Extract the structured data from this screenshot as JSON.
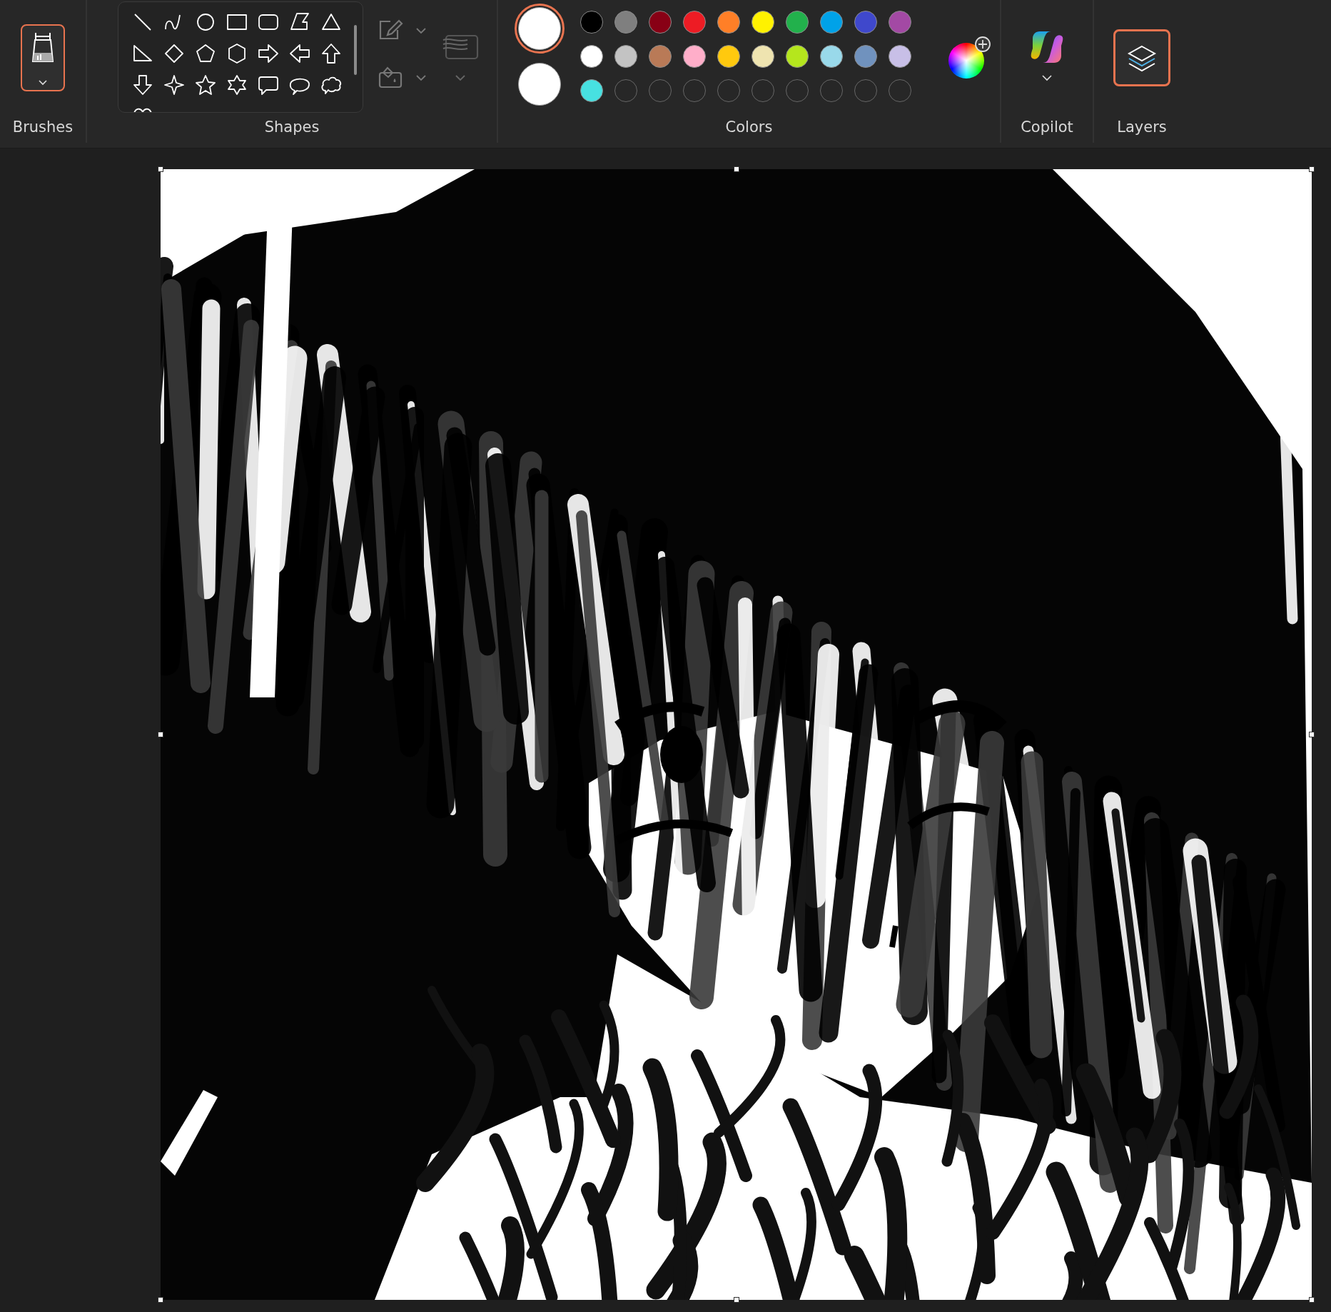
{
  "toolbar": {
    "brushes": {
      "label": "Brushes",
      "selected": true
    },
    "shapes": {
      "label": "Shapes"
    },
    "colors": {
      "label": "Colors",
      "current": [
        {
          "color": "#ffffff",
          "selected": true
        },
        {
          "color": "#ffffff",
          "selected": false
        }
      ],
      "palette": [
        {
          "kind": "swatch",
          "color": "#000000"
        },
        {
          "kind": "swatch",
          "color": "#7f7f7f"
        },
        {
          "kind": "swatch",
          "color": "#880015"
        },
        {
          "kind": "swatch",
          "color": "#ed1c24"
        },
        {
          "kind": "swatch",
          "color": "#ff7f27"
        },
        {
          "kind": "swatch",
          "color": "#fff200"
        },
        {
          "kind": "swatch",
          "color": "#22b14c"
        },
        {
          "kind": "swatch",
          "color": "#00a2e8"
        },
        {
          "kind": "swatch",
          "color": "#3f48cc"
        },
        {
          "kind": "swatch",
          "color": "#a349a4"
        },
        {
          "kind": "swatch",
          "color": "#ffffff"
        },
        {
          "kind": "swatch",
          "color": "#c3c3c3"
        },
        {
          "kind": "swatch",
          "color": "#b97a57"
        },
        {
          "kind": "swatch",
          "color": "#ffaec9"
        },
        {
          "kind": "swatch",
          "color": "#ffc90e"
        },
        {
          "kind": "swatch",
          "color": "#efe4b0"
        },
        {
          "kind": "swatch",
          "color": "#b5e61d"
        },
        {
          "kind": "swatch",
          "color": "#99d9ea"
        },
        {
          "kind": "swatch",
          "color": "#7092be"
        },
        {
          "kind": "swatch",
          "color": "#c8bfe7"
        },
        {
          "kind": "swatch",
          "color": "#47e1e1"
        },
        {
          "kind": "empty"
        },
        {
          "kind": "empty"
        },
        {
          "kind": "empty"
        },
        {
          "kind": "empty"
        },
        {
          "kind": "empty"
        },
        {
          "kind": "empty"
        },
        {
          "kind": "empty"
        },
        {
          "kind": "empty"
        },
        {
          "kind": "empty"
        }
      ]
    },
    "copilot": {
      "label": "Copilot"
    },
    "layers": {
      "label": "Layers",
      "selected": true
    }
  }
}
